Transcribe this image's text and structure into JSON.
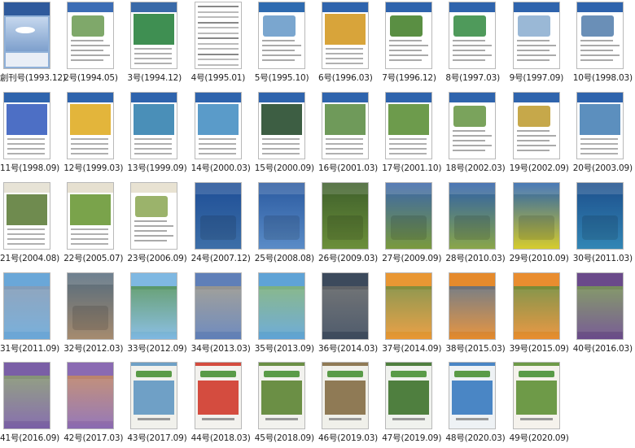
{
  "issues": [
    {
      "caption": "創刊号(1993.12)",
      "style": "a",
      "c1": "#2f5a9c",
      "c2": "#8fb0d8"
    },
    {
      "caption": "2号(1994.05)",
      "style": "b",
      "c1": "#3c6db5",
      "c2": "#7fa86a"
    },
    {
      "caption": "3号(1994.12)",
      "style": "c",
      "c1": "#3a6aa8",
      "c2": "#3f8f52"
    },
    {
      "caption": "4号(1995.01)",
      "style": "d",
      "c1": "#777777",
      "c2": "#cccccc"
    },
    {
      "caption": "5号(1995.10)",
      "style": "b",
      "c1": "#2f6bb0",
      "c2": "#7aa6cf"
    },
    {
      "caption": "6号(1996.03)",
      "style": "c",
      "c1": "#2f64ad",
      "c2": "#d8a43a"
    },
    {
      "caption": "7号(1996.12)",
      "style": "b",
      "c1": "#2f64ad",
      "c2": "#5a8f43"
    },
    {
      "caption": "8号(1997.03)",
      "style": "b",
      "c1": "#2f64ad",
      "c2": "#4f9a5b"
    },
    {
      "caption": "9号(1997.09)",
      "style": "b",
      "c1": "#2f64ad",
      "c2": "#9ab8d6"
    },
    {
      "caption": "10号(1998.03)",
      "style": "b",
      "c1": "#2f64ad",
      "c2": "#6a8fb7"
    },
    {
      "caption": "11号(1998.09)",
      "style": "c",
      "c1": "#2f64ad",
      "c2": "#4d6fc5"
    },
    {
      "caption": "12号(1999.03)",
      "style": "c",
      "c1": "#2f64ad",
      "c2": "#e3b53b"
    },
    {
      "caption": "13号(1999.09)",
      "style": "c",
      "c1": "#2f64ad",
      "c2": "#4a8fb8"
    },
    {
      "caption": "14号(2000.03)",
      "style": "c",
      "c1": "#2f64ad",
      "c2": "#5a9bc9"
    },
    {
      "caption": "15号(2000.09)",
      "style": "c",
      "c1": "#2f64ad",
      "c2": "#3d5e43"
    },
    {
      "caption": "16号(2001.03)",
      "style": "c",
      "c1": "#2f64ad",
      "c2": "#6f9a5a"
    },
    {
      "caption": "17号(2001.10)",
      "style": "c",
      "c1": "#2f64ad",
      "c2": "#6d9b4c"
    },
    {
      "caption": "18号(2002.03)",
      "style": "b",
      "c1": "#2f64ad",
      "c2": "#7aa35c"
    },
    {
      "caption": "19号(2002.09)",
      "style": "b",
      "c1": "#2f64ad",
      "c2": "#c6a84a"
    },
    {
      "caption": "20号(2003.09)",
      "style": "c",
      "c1": "#2f64ad",
      "c2": "#5c8fbe"
    },
    {
      "caption": "21号(2004.08)",
      "style": "c",
      "c1": "#e7e3d6",
      "c2": "#6f8b4f"
    },
    {
      "caption": "22号(2005.07)",
      "style": "c",
      "c1": "#e6e0d0",
      "c2": "#7aa34b"
    },
    {
      "caption": "23号(2006.09)",
      "style": "b",
      "c1": "#e8e2d2",
      "c2": "#9bb36b"
    },
    {
      "caption": "24号(2007.12)",
      "style": "e",
      "c1": "#1e4e96",
      "c2": "#3d6fa8"
    },
    {
      "caption": "25号(2008.08)",
      "style": "e",
      "c1": "#2b5aa0",
      "c2": "#5a8cc7"
    },
    {
      "caption": "26号(2009.03)",
      "style": "e",
      "c1": "#3e5f2b",
      "c2": "#6b8f3a"
    },
    {
      "caption": "27号(2009.09)",
      "style": "e",
      "c1": "#3b66a9",
      "c2": "#7a9a3e"
    },
    {
      "caption": "28号(2010.03)",
      "style": "e",
      "c1": "#2d5fa8",
      "c2": "#8aa64a"
    },
    {
      "caption": "29号(2010.09)",
      "style": "e",
      "c1": "#2b63aa",
      "c2": "#d6cc2e"
    },
    {
      "caption": "30号(2011.03)",
      "style": "e",
      "c1": "#1d4f8c",
      "c2": "#3286b5"
    },
    {
      "caption": "31号(2011.09)",
      "style": "f",
      "c1": "#6aa7d8",
      "c2": "#8a9ab0"
    },
    {
      "caption": "32号(2012.03)",
      "style": "e",
      "c1": "#556b7d",
      "c2": "#a58b6f"
    },
    {
      "caption": "33号(2012.09)",
      "style": "f",
      "c1": "#7fb8e2",
      "c2": "#4f8f4a"
    },
    {
      "caption": "34号(2013.03)",
      "style": "f",
      "c1": "#5f7fb8",
      "c2": "#a49b86"
    },
    {
      "caption": "35号(2013.09)",
      "style": "f",
      "c1": "#5fa3d6",
      "c2": "#84b46a"
    },
    {
      "caption": "36号(2014.03)",
      "style": "f",
      "c1": "#3c4a5c",
      "c2": "#6a6a6a"
    },
    {
      "caption": "37号(2014.09)",
      "style": "f",
      "c1": "#e99733",
      "c2": "#6a8a3f"
    },
    {
      "caption": "38号(2015.03)",
      "style": "f",
      "c1": "#e58a2c",
      "c2": "#4d6a8a"
    },
    {
      "caption": "39号(2015.09)",
      "style": "f",
      "c1": "#e98d2f",
      "c2": "#5b8a3a"
    },
    {
      "caption": "40号(2016.03)",
      "style": "f",
      "c1": "#6a4a8a",
      "c2": "#7a9f4e"
    },
    {
      "caption": "41号(2016.09)",
      "style": "f",
      "c1": "#7a5fa6",
      "c2": "#8aa36a"
    },
    {
      "caption": "42号(2017.03)",
      "style": "f",
      "c1": "#8a6ab2",
      "c2": "#c98b5a"
    },
    {
      "caption": "43号(2017.09)",
      "style": "g",
      "c1": "#f1f1ec",
      "c2": "#6fa0c6"
    },
    {
      "caption": "44号(2018.03)",
      "style": "g",
      "c1": "#f3f2ee",
      "c2": "#d44c3f"
    },
    {
      "caption": "45号(2018.09)",
      "style": "g",
      "c1": "#f2f2ee",
      "c2": "#6b8f45"
    },
    {
      "caption": "46号(2019.03)",
      "style": "g",
      "c1": "#f0f0ea",
      "c2": "#8f7a55"
    },
    {
      "caption": "47号(2019.09)",
      "style": "g",
      "c1": "#f0f2ee",
      "c2": "#4f7f3f"
    },
    {
      "caption": "48号(2020.03)",
      "style": "g",
      "c1": "#eef2f5",
      "c2": "#4a86c5"
    },
    {
      "caption": "49号(2020.09)",
      "style": "g",
      "c1": "#f5f2ec",
      "c2": "#6e9a48"
    }
  ]
}
